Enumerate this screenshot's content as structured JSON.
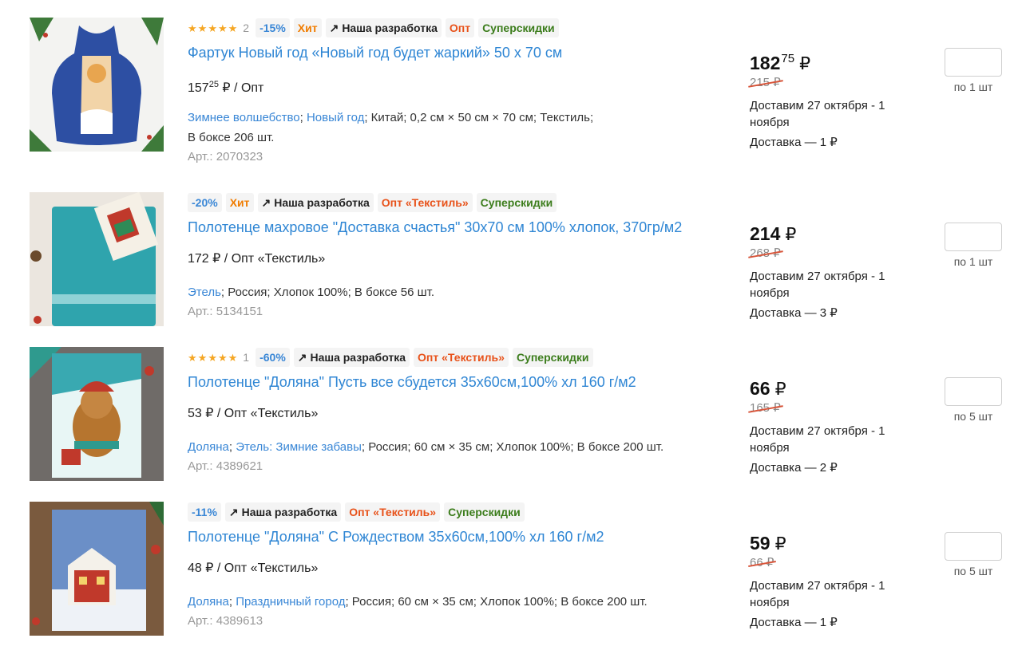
{
  "colors": {
    "link": "#2f86d4",
    "discount": "#3a87d6",
    "hit": "#f07c00",
    "opt": "#e8521a",
    "super": "#3c7d1c",
    "star": "#f5a623",
    "strike": "#d8553a"
  },
  "products": [
    {
      "rating": {
        "stars": 5,
        "count": "2"
      },
      "badges": {
        "discount": "-15%",
        "hit": "Хит",
        "dev": "Наша разработка",
        "opt": "Опт",
        "super": "Суперскидки"
      },
      "title": "Фартук Новый год «Новый год будет жаркий» 50 х 70 см",
      "opt_price": {
        "int": "157",
        "frac": "25",
        "currency": "₽",
        "label": "/ Опт"
      },
      "props": {
        "link1": "Зимнее волшебство",
        "sep": "; ",
        "link2": "Новый год",
        "rest": "; Китай; 0,2 см × 50 см × 70 см; Текстиль;",
        "line2": "В боксе 206 шт."
      },
      "article": "Арт.: 2070323",
      "price": {
        "int": "182",
        "frac": "75",
        "currency": "₽",
        "old": "215 ₽"
      },
      "delivery": {
        "date": "Доставим 27 октября - 1 ноября",
        "cost": "Доставка — 1 ₽"
      },
      "step": "по 1 шт",
      "image_icon": "apron-image"
    },
    {
      "rating": null,
      "badges": {
        "discount": "-20%",
        "hit": "Хит",
        "dev": "Наша разработка",
        "opt": "Опт «Текстиль»",
        "super": "Суперскидки"
      },
      "title": "Полотенце махровое \"Доставка счастья\" 30х70 см 100% хлопок, 370гр/м2",
      "opt_price": {
        "int": "172",
        "frac": "",
        "currency": "₽",
        "label": "/ Опт «Текстиль»"
      },
      "props": {
        "link1": "Этель",
        "sep": "",
        "link2": "",
        "rest": "; Россия; Хлопок 100%; В боксе 56 шт.",
        "line2": ""
      },
      "article": "Арт.: 5134151",
      "price": {
        "int": "214",
        "frac": "",
        "currency": "₽",
        "old": "268 ₽"
      },
      "delivery": {
        "date": "Доставим 27 октября - 1 ноября",
        "cost": "Доставка — 3 ₽"
      },
      "step": "по 1 шт",
      "image_icon": "towel-image"
    },
    {
      "rating": {
        "stars": 5,
        "count": "1"
      },
      "badges": {
        "discount": "-60%",
        "hit": "",
        "dev": "Наша разработка",
        "opt": "Опт «Текстиль»",
        "super": "Суперскидки"
      },
      "title": "Полотенце \"Доляна\" Пусть все сбудется 35х60см,100% хл 160 г/м2",
      "opt_price": {
        "int": "53",
        "frac": "",
        "currency": "₽",
        "label": "/ Опт «Текстиль»"
      },
      "props": {
        "link1": "Доляна",
        "sep": "; ",
        "link2": "Этель: Зимние забавы",
        "rest": "; Россия; 60 см × 35 см; Хлопок 100%; В боксе 200 шт.",
        "line2": ""
      },
      "article": "Арт.: 4389621",
      "price": {
        "int": "66",
        "frac": "",
        "currency": "₽",
        "old": "165 ₽"
      },
      "delivery": {
        "date": "Доставим 27 октября - 1 ноября",
        "cost": "Доставка — 2 ₽"
      },
      "step": "по 5 шт",
      "image_icon": "bear-towel-image"
    },
    {
      "rating": null,
      "badges": {
        "discount": "-11%",
        "hit": "",
        "dev": "Наша разработка",
        "opt": "Опт «Текстиль»",
        "super": "Суперскидки"
      },
      "title": "Полотенце \"Доляна\" С Рождеством 35х60см,100% хл 160 г/м2",
      "opt_price": {
        "int": "48",
        "frac": "",
        "currency": "₽",
        "label": "/ Опт «Текстиль»"
      },
      "props": {
        "link1": "Доляна",
        "sep": "; ",
        "link2": "Праздничный город",
        "rest": "; Россия; 60 см × 35 см; Хлопок 100%; В боксе 200 шт.",
        "line2": ""
      },
      "article": "Арт.: 4389613",
      "price": {
        "int": "59",
        "frac": "",
        "currency": "₽",
        "old": "66 ₽"
      },
      "delivery": {
        "date": "Доставим 27 октября - 1 ноября",
        "cost": "Доставка — 1 ₽"
      },
      "step": "по 5 шт",
      "image_icon": "christmas-towel-image"
    }
  ]
}
